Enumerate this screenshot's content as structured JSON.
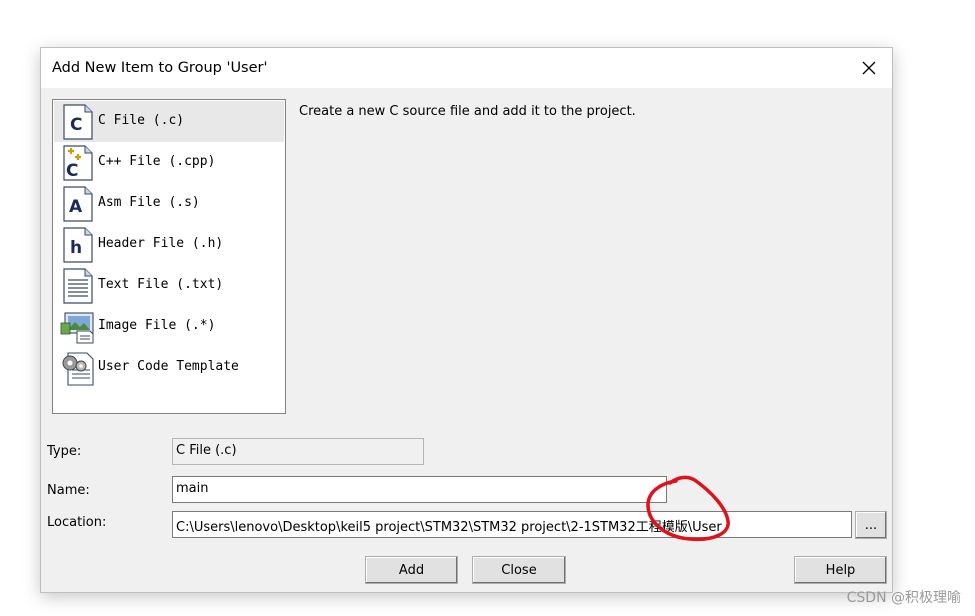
{
  "dialog": {
    "title": "Add New Item to Group 'User'",
    "close_icon": "close-icon"
  },
  "file_types": [
    {
      "label": "C File (.c)",
      "icon": "c-file-icon",
      "selected": true
    },
    {
      "label": "C++ File (.cpp)",
      "icon": "cpp-file-icon",
      "selected": false
    },
    {
      "label": "Asm File (.s)",
      "icon": "asm-file-icon",
      "selected": false
    },
    {
      "label": "Header File (.h)",
      "icon": "header-file-icon",
      "selected": false
    },
    {
      "label": "Text File (.txt)",
      "icon": "text-file-icon",
      "selected": false
    },
    {
      "label": "Image File (.*)",
      "icon": "image-file-icon",
      "selected": false
    },
    {
      "label": "User Code Template",
      "icon": "user-code-template-icon",
      "selected": false
    }
  ],
  "description": "Create a new C source file and add it to the project.",
  "fields": {
    "type_label": "Type:",
    "type_value": "C File (.c)",
    "name_label": "Name:",
    "name_value": "main",
    "location_label": "Location:",
    "location_value": "C:\\Users\\lenovo\\Desktop\\keil5 project\\STM32\\STM32 project\\2-1STM32工程模版\\User"
  },
  "buttons": {
    "browse": "...",
    "add": "Add",
    "close": "Close",
    "help": "Help"
  },
  "annotation": {
    "color": "#e0111b"
  },
  "watermark": "CSDN @积极理喻"
}
